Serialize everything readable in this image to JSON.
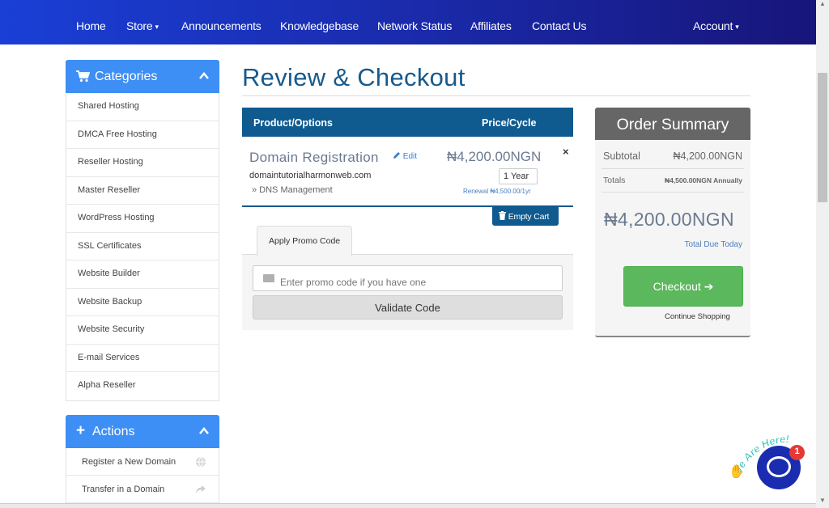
{
  "nav": {
    "items": [
      {
        "label": "Home",
        "has_caret": false
      },
      {
        "label": "Store",
        "has_caret": true
      },
      {
        "label": "Announcements",
        "has_caret": false
      },
      {
        "label": "Knowledgebase",
        "has_caret": false
      },
      {
        "label": "Network Status",
        "has_caret": false
      },
      {
        "label": "Affiliates",
        "has_caret": false
      },
      {
        "label": "Contact Us",
        "has_caret": false
      }
    ],
    "account": "Account",
    "caret": "▾"
  },
  "sidebar": {
    "categories_title": "Categories",
    "categories": [
      "Shared Hosting",
      "DMCA Free Hosting",
      "Reseller Hosting",
      "Master Reseller",
      "WordPress Hosting",
      "SSL Certificates",
      "Website Builder",
      "Website Backup",
      "Website Security",
      "E-mail Services",
      "Alpha Reseller"
    ],
    "actions_title": "Actions",
    "actions": [
      {
        "label": "Register a New Domain",
        "icon": "globe-icon"
      },
      {
        "label": "Transfer in a Domain",
        "icon": "share-arrow-icon"
      }
    ]
  },
  "main": {
    "page_title": "Review & Checkout",
    "table_headers": {
      "product": "Product/Options",
      "price": "Price/Cycle"
    },
    "item": {
      "name": "Domain Registration",
      "edit": "Edit",
      "domain": "domaintutorialharmonweb.com",
      "addon": "» DNS Management",
      "price": "₦4,200.00NGN",
      "cycle": "1 Year",
      "renewal": "Renewal ₦4,500.00/1yr",
      "remove": "×"
    },
    "empty_cart": "Empty Cart",
    "promo_tab": "Apply Promo Code",
    "promo_placeholder": "Enter promo code if you have one",
    "validate": "Validate Code"
  },
  "summary": {
    "title": "Order Summary",
    "subtotal_label": "Subtotal",
    "subtotal_value": "₦4,200.00NGN",
    "totals_label": "Totals",
    "totals_value": "₦4,500.00NGN Annually",
    "total_due": "₦4,200.00NGN",
    "total_due_label": "Total Due Today",
    "checkout": "Checkout",
    "checkout_arrow": "➔",
    "continue": "Continue Shopping"
  },
  "chat": {
    "banner": "We Are Here!",
    "badge": "1"
  },
  "colors": {
    "nav_start": "#1a3fd6",
    "nav_end": "#17157a",
    "panel_blue": "#3d8ff5",
    "table_blue": "#0f5a8f",
    "checkout_green": "#5cb85c"
  }
}
